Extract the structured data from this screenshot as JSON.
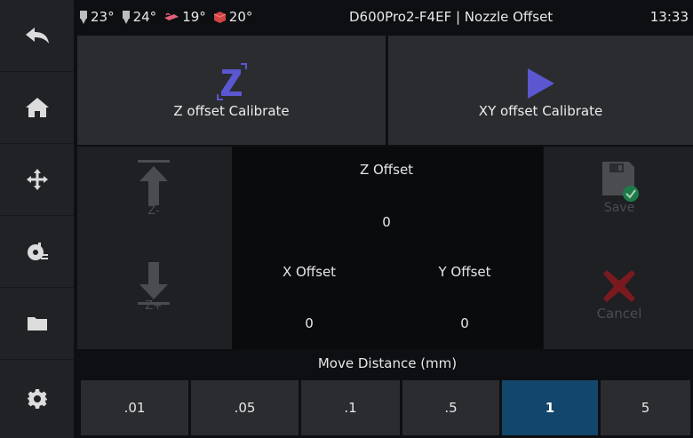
{
  "status": {
    "temps": [
      {
        "icon": "extruder-icon",
        "value": "23°"
      },
      {
        "icon": "extruder-icon",
        "value": "24°"
      },
      {
        "icon": "bed-icon",
        "value": "19°"
      },
      {
        "icon": "chamber-icon",
        "value": "20°"
      }
    ],
    "title": "D600Pro2-F4EF | Nozzle Offset",
    "time": "13:33"
  },
  "sidebar": {
    "items": [
      {
        "icon": "back-icon"
      },
      {
        "icon": "home-icon"
      },
      {
        "icon": "move-icon"
      },
      {
        "icon": "extrude-icon"
      },
      {
        "icon": "folder-icon"
      },
      {
        "icon": "settings-icon"
      }
    ]
  },
  "calibrate": {
    "z_label": "Z offset Calibrate",
    "xy_label": "XY offset Calibrate"
  },
  "controls": {
    "z_minus": "Z-",
    "z_plus": "Z+",
    "save": "Save",
    "cancel": "Cancel"
  },
  "offsets": {
    "z_label": "Z Offset",
    "z_value": "0",
    "x_label": "X Offset",
    "x_value": "0",
    "y_label": "Y Offset",
    "y_value": "0"
  },
  "move_distance": {
    "label": "Move Distance (mm)",
    "options": [
      ".01",
      ".05",
      ".1",
      ".5",
      "1",
      "5"
    ],
    "selected": "1"
  },
  "colors": {
    "accent": "#5b57d1",
    "selected": "#13466b",
    "cancel": "#7a1a1f",
    "save_check": "#1f7a4a"
  }
}
